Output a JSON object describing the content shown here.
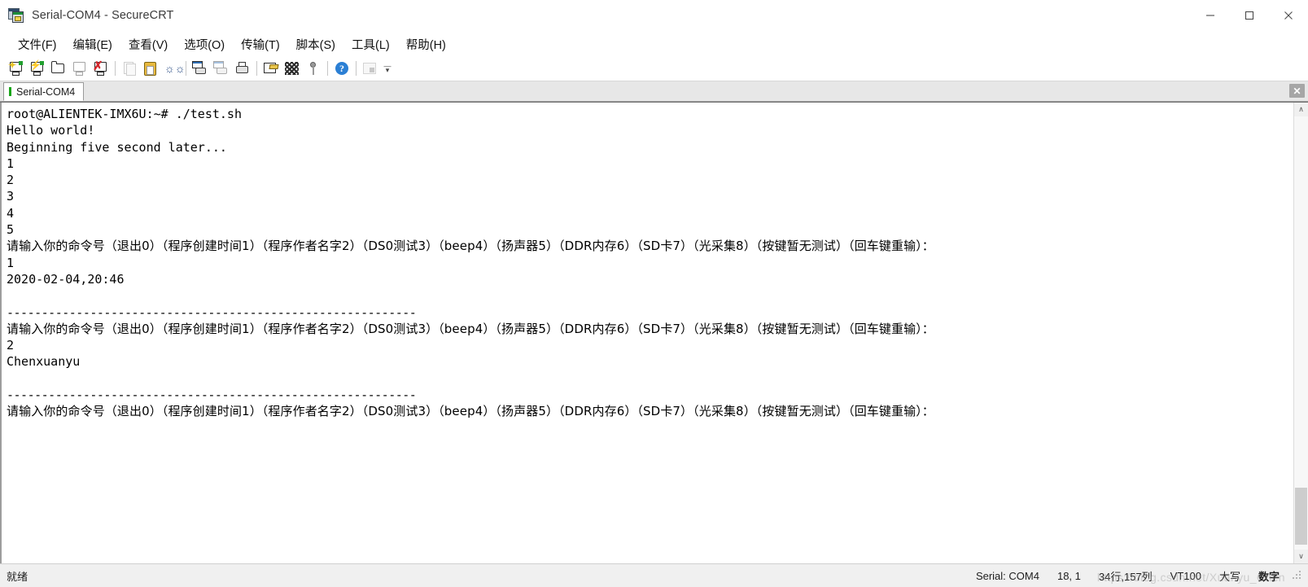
{
  "window": {
    "title": "Serial-COM4 - SecureCRT",
    "app_icon": "secure-crt-icon",
    "minimize_label": "—",
    "maximize_label": "□",
    "close_label": "✕"
  },
  "menu": {
    "items": [
      {
        "label": "文件(F)",
        "name": "menu-file"
      },
      {
        "label": "编辑(E)",
        "name": "menu-edit"
      },
      {
        "label": "查看(V)",
        "name": "menu-view"
      },
      {
        "label": "选项(O)",
        "name": "menu-options"
      },
      {
        "label": "传输(T)",
        "name": "menu-transfer"
      },
      {
        "label": "脚本(S)",
        "name": "menu-script"
      },
      {
        "label": "工具(L)",
        "name": "menu-tools"
      },
      {
        "label": "帮助(H)",
        "name": "menu-help"
      }
    ]
  },
  "toolbar": {
    "buttons": [
      "new-session-icon",
      "quick-connect-icon",
      "connect-in-tab-icon",
      "reconnect-icon",
      "disconnect-icon",
      "copy-icon",
      "paste-icon",
      "find-icon",
      "print-screen-icon",
      "log-session-icon",
      "print-icon",
      "session-options-icon",
      "scramble-icon",
      "key-icon",
      "help-icon",
      "lock-screen-icon"
    ],
    "overflow_label": "▾"
  },
  "tabs": {
    "items": [
      {
        "label": "Serial-COM4",
        "active": true,
        "status_color": "#19a519"
      }
    ],
    "close_label": "✕"
  },
  "terminal": {
    "lines": [
      "root@ALIENTEK-IMX6U:~# ./test.sh",
      "Hello world!",
      "Beginning five second later...",
      "1",
      "2",
      "3",
      "4",
      "5",
      "请输入你的命令号（退出0）（程序创建时间1）（程序作者名字2）（DS0测试3）（beep4）（扬声器5）（DDR内存6）（SD卡7）（光采集8）（按键暂无测试）（回车键重输）：",
      "1",
      "2020-02-04,20:46",
      "",
      "-----------------------------------------------------------",
      "请输入你的命令号（退出0）（程序创建时间1）（程序作者名字2）（DS0测试3）（beep4）（扬声器5）（DDR内存6）（SD卡7）（光采集8）（按键暂无测试）（回车键重输）：",
      "2",
      "Chenxuanyu",
      "",
      "-----------------------------------------------------------",
      "请输入你的命令号（退出0）（程序创建时间1）（程序作者名字2）（DS0测试3）（beep4）（扬声器5）（DDR内存6）（SD卡7）（光采集8）（按键暂无测试）（回车键重输）："
    ],
    "foreground": "#000000",
    "background": "#ffffff"
  },
  "scrollbar": {
    "up_label": "∧",
    "down_label": "∨"
  },
  "statusbar": {
    "ready": "就绪",
    "connection": "Serial: COM4",
    "cursor": "18,  1",
    "size": "34行,157列",
    "emulation": "VT100",
    "caps": "大写",
    "num": "数字"
  },
  "watermark": "https://blog.csdn.net/Xuanyu_Chen"
}
